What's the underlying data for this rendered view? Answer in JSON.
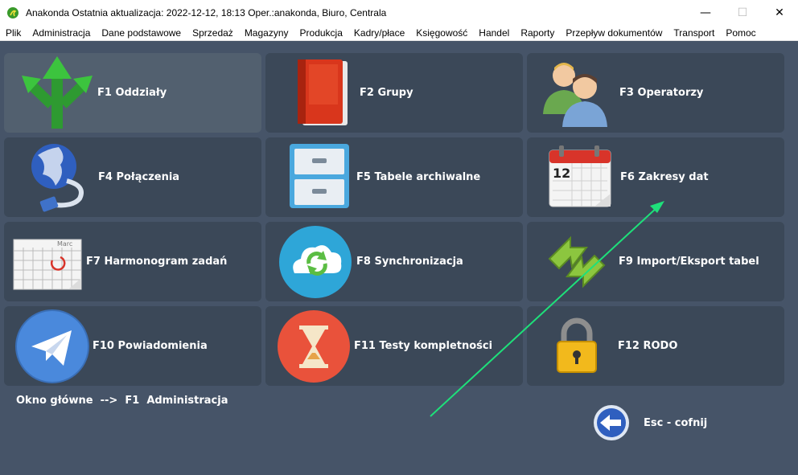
{
  "window": {
    "title": "Anakonda Ostatnia aktualizacja: 2022-12-12, 18:13 Oper.:anakonda, Biuro, Centrala",
    "minimize": "—",
    "maximize": "☐",
    "close": "✕"
  },
  "menu": [
    "Plik",
    "Administracja",
    "Dane podstawowe",
    "Sprzedaż",
    "Magazyny",
    "Produkcja",
    "Kadry/płace",
    "Księgowość",
    "Handel",
    "Raporty",
    "Przepływ dokumentów",
    "Transport",
    "Pomoc"
  ],
  "tiles": [
    {
      "label": "F1  Oddziały",
      "icon": "green-arrows-icon"
    },
    {
      "label": "F2  Grupy",
      "icon": "red-book-icon"
    },
    {
      "label": "F3  Operatorzy",
      "icon": "users-icon"
    },
    {
      "label": "F4  Połączenia",
      "icon": "globe-network-icon"
    },
    {
      "label": "F5  Tabele archiwalne",
      "icon": "filing-cabinet-icon"
    },
    {
      "label": "F6  Zakresy dat",
      "icon": "calendar-icon"
    },
    {
      "label": "F7  Harmonogram zadań",
      "icon": "schedule-calendar-icon"
    },
    {
      "label": "F8  Synchronizacja",
      "icon": "cloud-sync-icon"
    },
    {
      "label": "F9  Import/Eksport tabel",
      "icon": "import-export-arrows-icon"
    },
    {
      "label": "F10  Powiadomienia",
      "icon": "telegram-icon"
    },
    {
      "label": "F11  Testy kompletności",
      "icon": "hourglass-icon"
    },
    {
      "label": "F12  RODO",
      "icon": "padlock-icon"
    }
  ],
  "calendar_day": "12",
  "calendar_month": "Marc",
  "breadcrumb": "Okno główne  -->  F1  Administracja",
  "back": {
    "label": "Esc - cofnij"
  },
  "colors": {
    "background": "#465468",
    "tile": "#3b4858",
    "tile_active": "#52606f",
    "annotation_arrow": "#1ee07a"
  }
}
